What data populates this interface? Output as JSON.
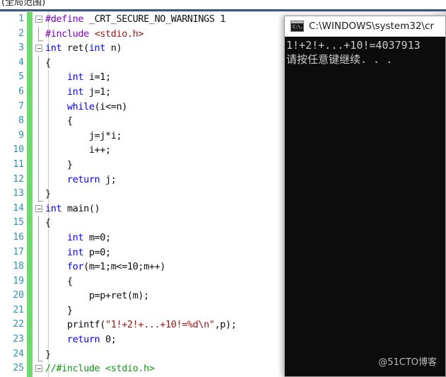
{
  "toolbar": {
    "scope_selector_value": "(全局范围)"
  },
  "editor": {
    "lines": [
      {
        "num": "1",
        "text": "#define _CRT_SECURE_NO_WARNINGS 1",
        "fold": true,
        "guide": false,
        "guide_cap": false
      },
      {
        "num": "2",
        "text": "#include <stdio.h>",
        "fold": false,
        "guide": true,
        "guide_cap": true
      },
      {
        "num": "3",
        "text": "int ret(int n)",
        "fold": true,
        "guide": false,
        "guide_cap": false
      },
      {
        "num": "4",
        "text": "{",
        "fold": false,
        "guide": true,
        "guide_cap": false
      },
      {
        "num": "5",
        "text": "    int i=1;",
        "fold": false,
        "guide": true,
        "guide_cap": false
      },
      {
        "num": "6",
        "text": "    int j=1;",
        "fold": false,
        "guide": true,
        "guide_cap": false
      },
      {
        "num": "7",
        "text": "    while(i<=n)",
        "fold": false,
        "guide": true,
        "guide_cap": false
      },
      {
        "num": "8",
        "text": "    {",
        "fold": false,
        "guide": true,
        "guide_cap": false
      },
      {
        "num": "9",
        "text": "        j=j*i;",
        "fold": false,
        "guide": true,
        "guide_cap": false
      },
      {
        "num": "10",
        "text": "        i++;",
        "fold": false,
        "guide": true,
        "guide_cap": false
      },
      {
        "num": "11",
        "text": "    }",
        "fold": false,
        "guide": true,
        "guide_cap": false
      },
      {
        "num": "12",
        "text": "    return j;",
        "fold": false,
        "guide": true,
        "guide_cap": false
      },
      {
        "num": "13",
        "text": "}",
        "fold": false,
        "guide": true,
        "guide_cap": true
      },
      {
        "num": "14",
        "text": "int main()",
        "fold": true,
        "guide": false,
        "guide_cap": false
      },
      {
        "num": "15",
        "text": "{",
        "fold": false,
        "guide": true,
        "guide_cap": false
      },
      {
        "num": "16",
        "text": "    int m=0;",
        "fold": false,
        "guide": true,
        "guide_cap": false
      },
      {
        "num": "17",
        "text": "    int p=0;",
        "fold": false,
        "guide": true,
        "guide_cap": false
      },
      {
        "num": "18",
        "text": "    for(m=1;m<=10;m++)",
        "fold": false,
        "guide": true,
        "guide_cap": false
      },
      {
        "num": "19",
        "text": "    {",
        "fold": false,
        "guide": true,
        "guide_cap": false
      },
      {
        "num": "20",
        "text": "        p=p+ret(m);",
        "fold": false,
        "guide": true,
        "guide_cap": false
      },
      {
        "num": "21",
        "text": "    }",
        "fold": false,
        "guide": true,
        "guide_cap": false
      },
      {
        "num": "22",
        "text": "    printf(\"1!+2!+...+10!=%d\\n\",p);",
        "fold": false,
        "guide": true,
        "guide_cap": false
      },
      {
        "num": "23",
        "text": "    return 0;",
        "fold": false,
        "guide": true,
        "guide_cap": false
      },
      {
        "num": "24",
        "text": "}",
        "fold": false,
        "guide": true,
        "guide_cap": true
      },
      {
        "num": "25",
        "text": "//#include <stdio.h>",
        "fold": true,
        "guide": false,
        "guide_cap": false
      }
    ]
  },
  "console": {
    "title": "C:\\WINDOWS\\system32\\cr",
    "icon": "cmd-icon",
    "prompt_glyph": "C:\\.",
    "output_lines": [
      "1!+2!+...+10!=4037913",
      "请按任意键继续. . ."
    ],
    "watermark": "@51CTO博客"
  },
  "colors": {
    "keyword": "#0000ff",
    "preprocessor": "#8000c8",
    "string": "#a31515",
    "comment": "#119911",
    "linenumber": "#2b91af",
    "change_bar": "#6fd96f",
    "console_bg": "#0c0c0c",
    "console_fg": "#cccccc"
  }
}
